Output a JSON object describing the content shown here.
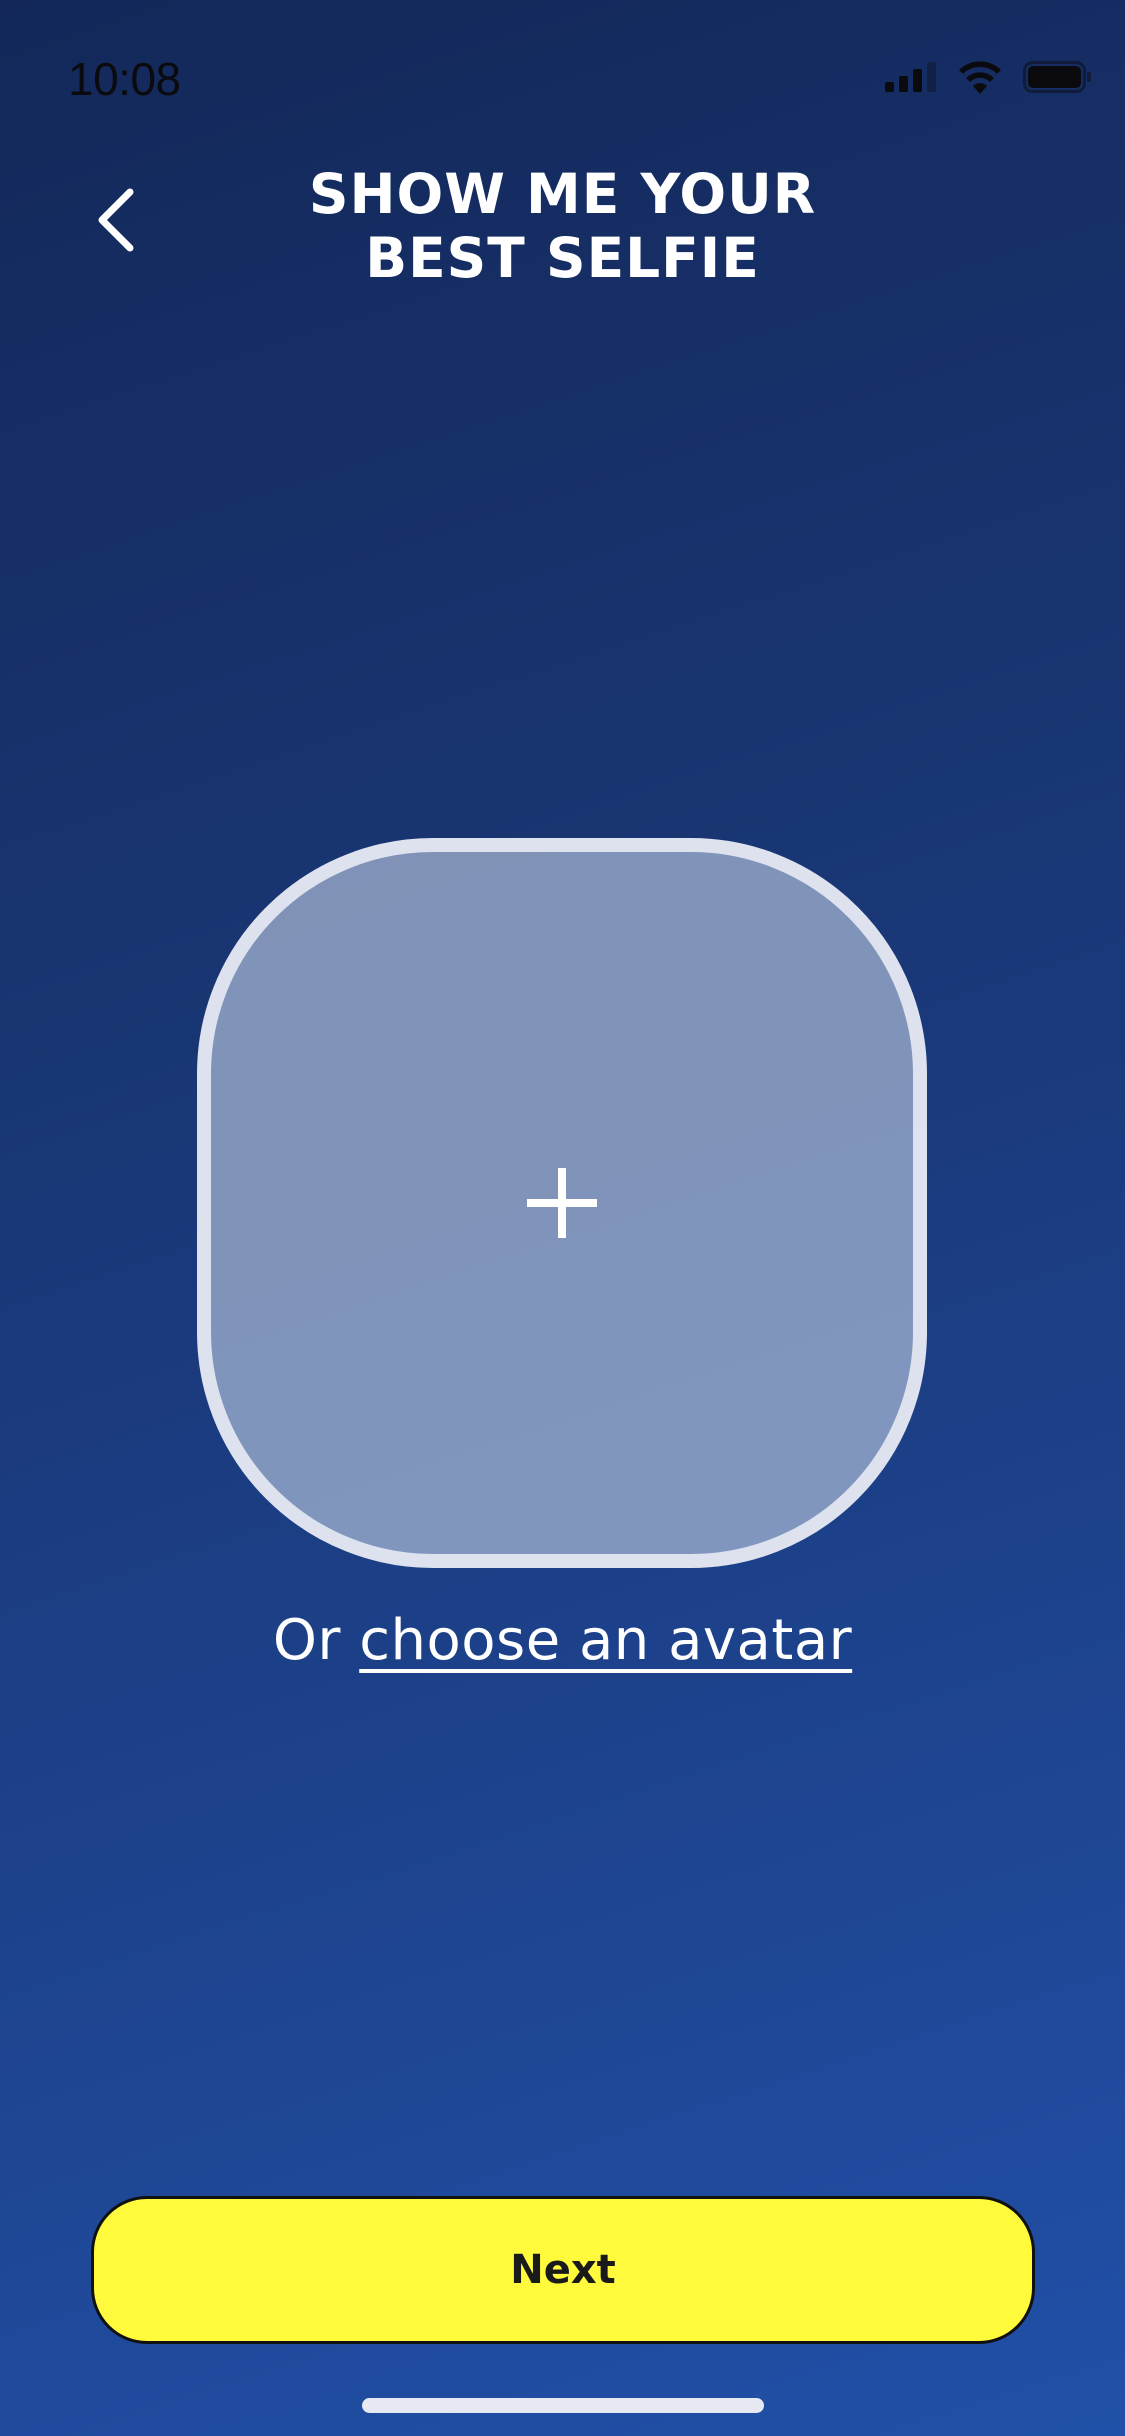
{
  "status_bar": {
    "time": "10:08",
    "icons": [
      "signal-icon",
      "wifi-icon",
      "battery-icon"
    ]
  },
  "header": {
    "back_icon": "chevron-left-icon",
    "title_line1": "SHOW ME YOUR",
    "title_line2": "BEST SELFIE"
  },
  "photo_picker": {
    "icon": "plus-icon"
  },
  "avatar_option": {
    "prefix": "Or",
    "link_label": "choose an avatar"
  },
  "footer": {
    "next_label": "Next"
  },
  "colors": {
    "background_top": "#132859",
    "background_bottom": "#2150a8",
    "accent_button": "#fffb3c",
    "picker_border": "#dde2ee"
  }
}
